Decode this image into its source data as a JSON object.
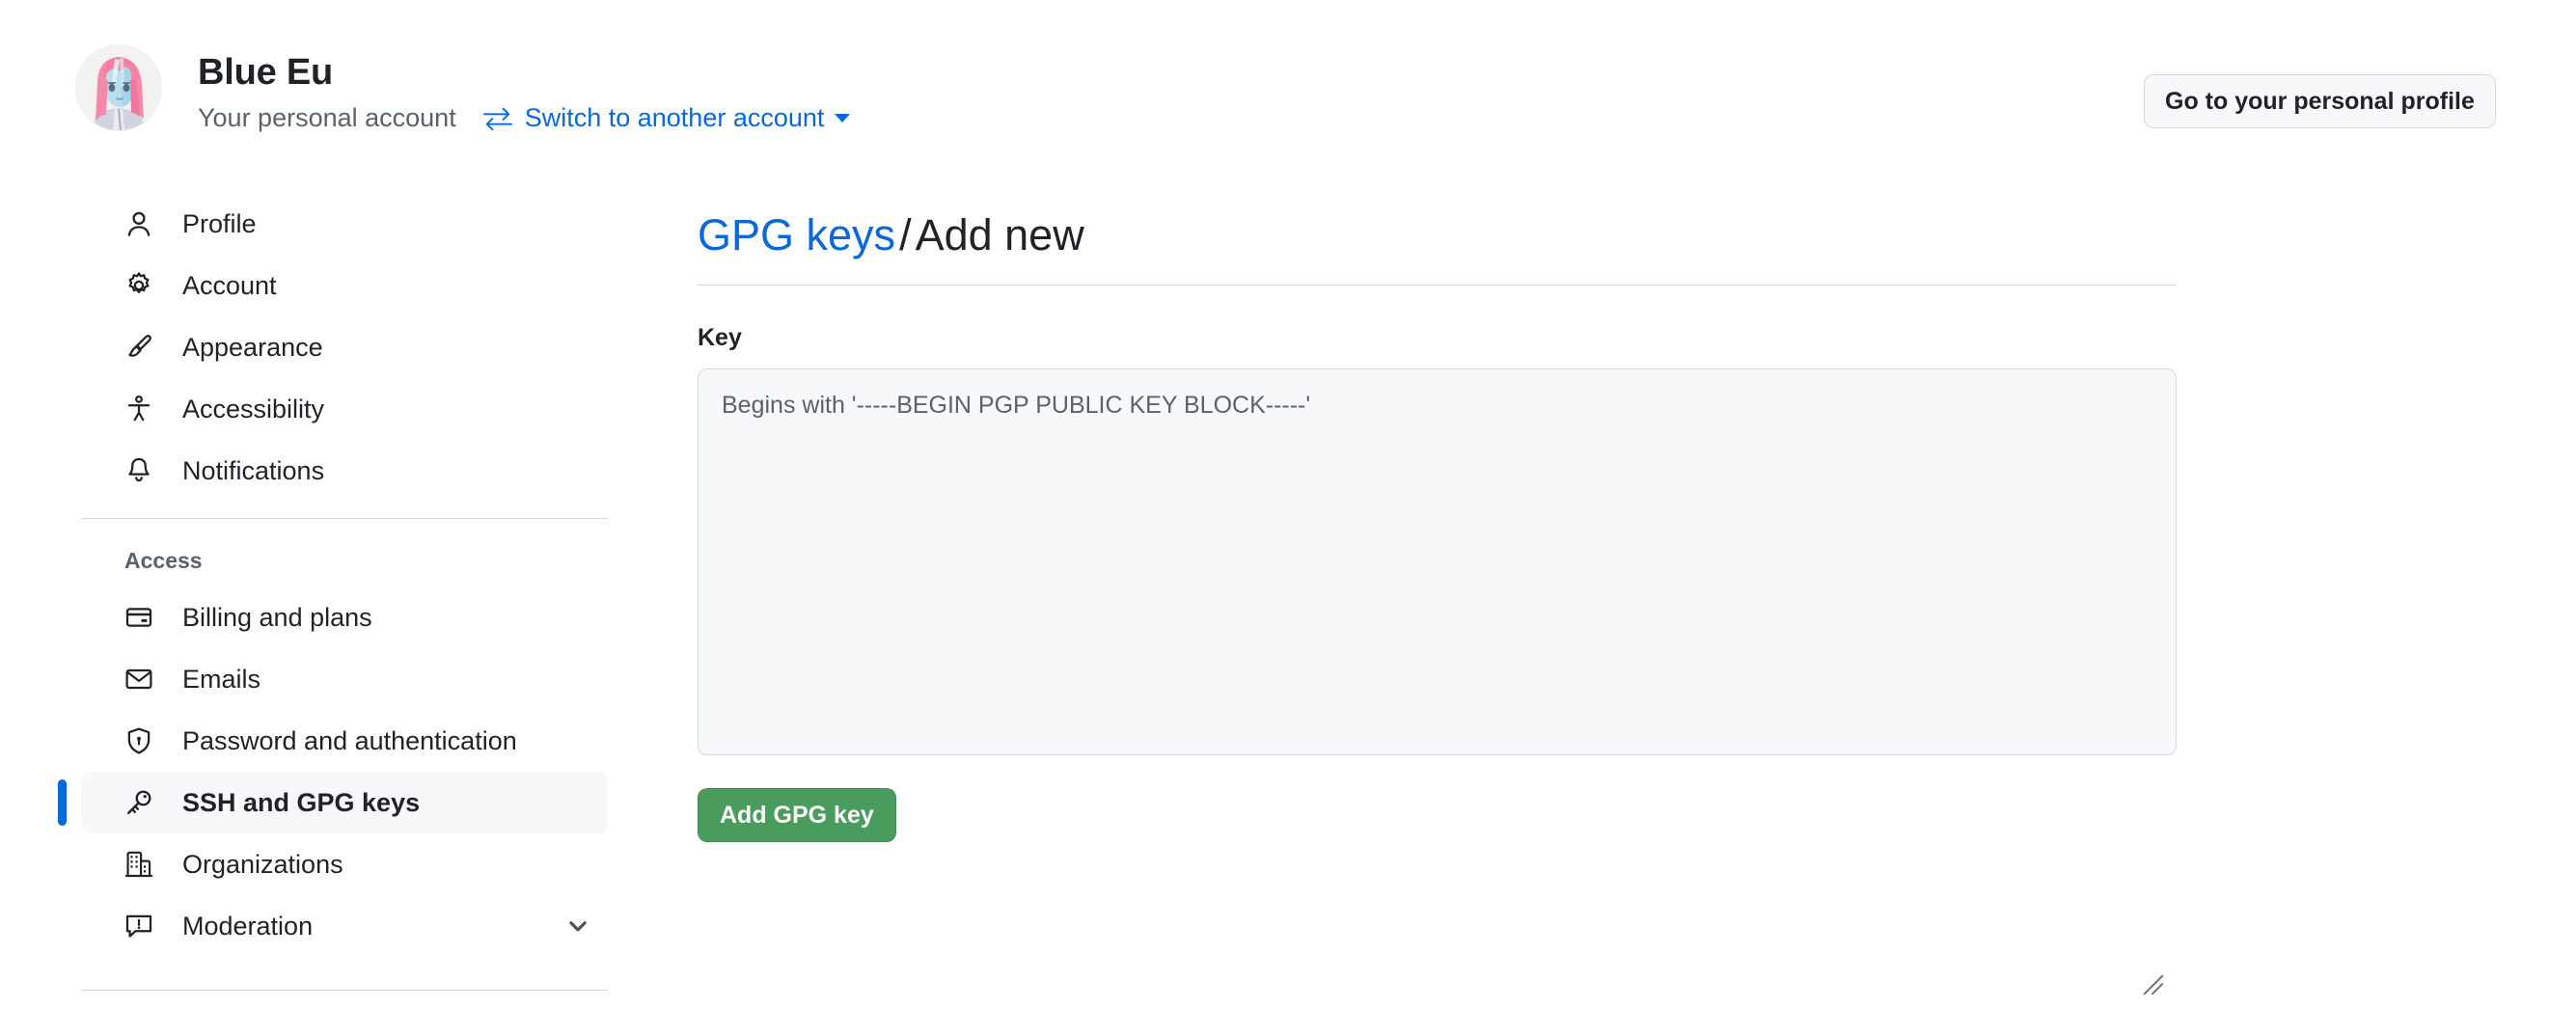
{
  "account_header": {
    "avatar_alt": "user-avatar",
    "name": "Blue Eu",
    "account_type": "Your personal account",
    "switch_account_label": "Switch to another account",
    "switch_account_icon": "arrow-switch-icon",
    "caret_icon": "caret-down-icon",
    "personal_profile_button": "Go to your personal profile"
  },
  "sidebar": {
    "primary_items": [
      {
        "label": "Profile",
        "icon": "person-icon",
        "selected": false
      },
      {
        "label": "Account",
        "icon": "gear-icon",
        "selected": false
      },
      {
        "label": "Appearance",
        "icon": "paintbrush-icon",
        "selected": false
      },
      {
        "label": "Accessibility",
        "icon": "accessibility-icon",
        "selected": false
      },
      {
        "label": "Notifications",
        "icon": "bell-icon",
        "selected": false
      }
    ],
    "access_section": {
      "title": "Access",
      "items": [
        {
          "label": "Billing and plans",
          "icon": "credit-card-icon",
          "selected": false,
          "expandable": false
        },
        {
          "label": "Emails",
          "icon": "mail-icon",
          "selected": false,
          "expandable": false
        },
        {
          "label": "Password and authentication",
          "icon": "shield-lock-icon",
          "selected": false,
          "expandable": false
        },
        {
          "label": "SSH and GPG keys",
          "icon": "key-icon",
          "selected": true,
          "expandable": false
        },
        {
          "label": "Organizations",
          "icon": "organization-icon",
          "selected": false,
          "expandable": false
        },
        {
          "label": "Moderation",
          "icon": "report-icon",
          "selected": false,
          "expandable": true
        }
      ]
    }
  },
  "main": {
    "breadcrumb_link": "GPG keys",
    "breadcrumb_separator": "/",
    "breadcrumb_current": "Add new",
    "key_field_label": "Key",
    "key_textarea_value": "",
    "key_textarea_placeholder": "Begins with '-----BEGIN PGP PUBLIC KEY BLOCK-----'",
    "submit_button_label": "Add GPG key"
  },
  "colors": {
    "accent_blue": "#0969da",
    "success_green": "#4a9c5d",
    "text_primary": "#1f2328",
    "text_muted": "#59636e",
    "border": "#d1d9e0",
    "surface_subtle": "#f6f8fa"
  }
}
